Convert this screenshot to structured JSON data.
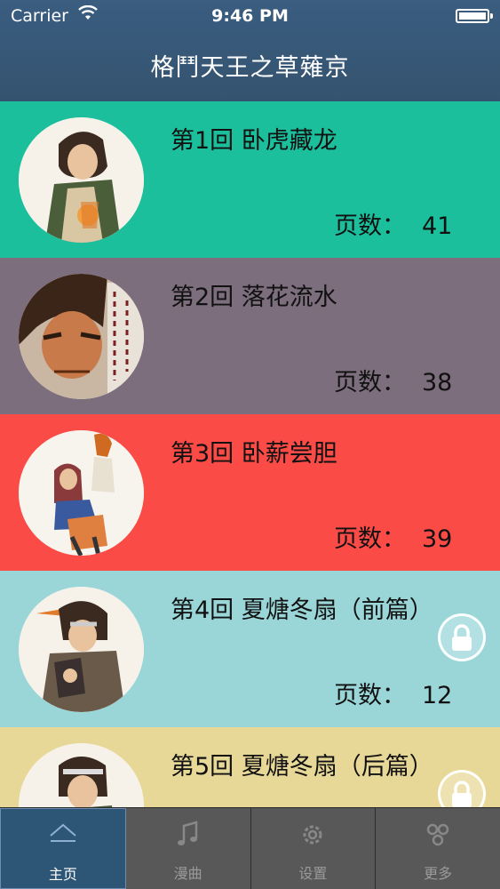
{
  "status_bar": {
    "carrier": "Carrier",
    "time": "9:46 PM"
  },
  "header": {
    "title": "格鬥天王之草薙京"
  },
  "episodes": [
    {
      "title": "第1回 卧虎藏龙",
      "pages_label": "页数：",
      "pages": "41",
      "bg": "#1bbf9c",
      "locked": false
    },
    {
      "title": "第2回 落花流水",
      "pages_label": "页数：",
      "pages": "38",
      "bg": "#7c6e7c",
      "locked": false
    },
    {
      "title": "第3回 卧薪尝胆",
      "pages_label": "页数：",
      "pages": "39",
      "bg": "#fa4b47",
      "locked": false
    },
    {
      "title": "第4回 夏煻冬扇（前篇）",
      "pages_label": "页数：",
      "pages": "12",
      "bg": "#9ad6d8",
      "locked": true
    },
    {
      "title": "第5回 夏煻冬扇（后篇）",
      "pages_label": "",
      "pages": "",
      "bg": "#e8d898",
      "locked": true
    }
  ],
  "tabbar": {
    "tabs": [
      {
        "label": "主页",
        "icon": "home-icon",
        "active": true
      },
      {
        "label": "漫曲",
        "icon": "music-icon",
        "active": false
      },
      {
        "label": "设置",
        "icon": "gear-icon",
        "active": false
      },
      {
        "label": "更多",
        "icon": "more-icon",
        "active": false
      }
    ]
  }
}
